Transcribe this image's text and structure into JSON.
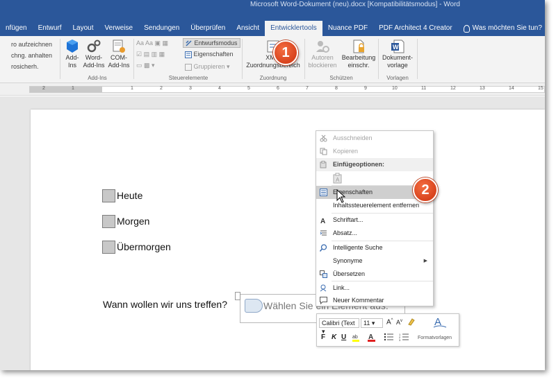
{
  "window": {
    "title": "Microsoft Word-Dokument (neu).docx [Kompatibilitätsmodus] - Word"
  },
  "tabs": [
    {
      "label": "nfügen"
    },
    {
      "label": "Entwurf"
    },
    {
      "label": "Layout"
    },
    {
      "label": "Verweise"
    },
    {
      "label": "Sendungen"
    },
    {
      "label": "Überprüfen"
    },
    {
      "label": "Ansicht"
    },
    {
      "label": "Entwicklertools"
    },
    {
      "label": "Nuance PDF"
    },
    {
      "label": "PDF Architect 4 Creator"
    },
    {
      "label": "Was möchten Sie tun?"
    }
  ],
  "ribbon": {
    "code": {
      "record_macro": "ro aufzeichnen",
      "pause_recording": "chng. anhalten",
      "macro_security": "rosicherh."
    },
    "addins": {
      "addins_label": "Add-\nIns",
      "word_addins_label": "Word-\nAdd-Ins",
      "com_addins_label": "COM-\nAdd-Ins",
      "group_label": "Add-Ins"
    },
    "controls": {
      "design_mode": "Entwurfsmodus",
      "properties": "Eigenschaften",
      "group": "Gruppieren",
      "group_label": "Steuerelemente"
    },
    "mapping": {
      "xml_mapping_label": "XML-\nZuordnungsbereich",
      "group_label": "Zuordnung"
    },
    "protect": {
      "block_authors_label": "Autoren\nblockieren",
      "restrict_editing_label": "Bearbeitung\neinschr.",
      "group_label": "Schützen"
    },
    "templates": {
      "document_template_label": "Dokument-\nvorlage",
      "group_label": "Vorlagen"
    }
  },
  "ruler": {
    "labels": [
      "2",
      "1",
      "1",
      "2",
      "3",
      "4",
      "5",
      "6",
      "7",
      "8",
      "9",
      "10",
      "11",
      "12",
      "13",
      "14",
      "15"
    ]
  },
  "document": {
    "checkboxes": [
      {
        "label": "Heute"
      },
      {
        "label": "Morgen"
      },
      {
        "label": "Übermorgen"
      }
    ],
    "question": "Wann wollen wir uns treffen?",
    "dropdown_placeholder": "Wählen Sie ein Element aus."
  },
  "context_menu": {
    "items": [
      {
        "label": "Ausschneiden",
        "icon": "scissors-icon",
        "disabled": true
      },
      {
        "label": "Kopieren",
        "icon": "copy-icon",
        "disabled": true
      },
      {
        "label": "Einfügeoptionen:",
        "icon": "paste-icon",
        "header": true
      },
      {
        "label": "",
        "icon": "paste-keep-text-icon",
        "disabled": true
      },
      {
        "label": "Eigenschaften",
        "icon": "properties-icon",
        "highlighted": true
      },
      {
        "label": "Inhaltssteuerelement entfernen",
        "icon": "",
        "disabled": false
      },
      {
        "label": "Schriftart...",
        "icon": "font-icon"
      },
      {
        "label": "Absatz...",
        "icon": "paragraph-icon"
      },
      {
        "label": "Intelligente Suche",
        "icon": "smart-lookup-icon"
      },
      {
        "label": "Synonyme",
        "icon": "",
        "submenu": true
      },
      {
        "label": "Übersetzen",
        "icon": "translate-icon"
      },
      {
        "label": "Link...",
        "icon": "link-icon"
      },
      {
        "label": "Neuer Kommentar",
        "icon": "comment-icon"
      }
    ]
  },
  "mini_toolbar": {
    "font": "Calibri (Text",
    "size": "11",
    "grow_font": "A",
    "shrink_font": "A",
    "bold": "F",
    "italic": "K",
    "underline": "U",
    "styles_label": "Formatvorlagen"
  },
  "callouts": [
    {
      "number": "1"
    },
    {
      "number": "2"
    }
  ],
  "colors": {
    "title_bar": "#2b579a",
    "callout": "#e0502a",
    "highlight": "#cfcfcf"
  }
}
